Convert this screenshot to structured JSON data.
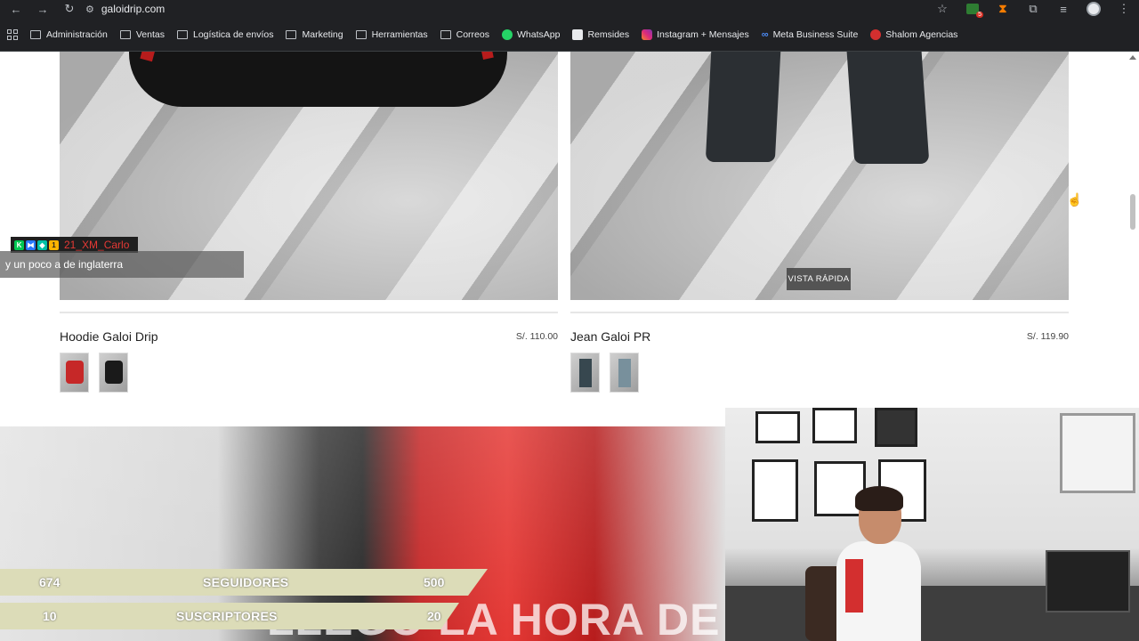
{
  "browser": {
    "url": "galoidrip.com",
    "bookmarks": [
      {
        "label": "Administración",
        "icon": "folder-icon"
      },
      {
        "label": "Ventas",
        "icon": "folder-icon"
      },
      {
        "label": "Logística de envíos",
        "icon": "folder-icon"
      },
      {
        "label": "Marketing",
        "icon": "folder-icon"
      },
      {
        "label": "Herramientas",
        "icon": "folder-icon"
      },
      {
        "label": "Correos",
        "icon": "folder-icon"
      },
      {
        "label": "WhatsApp",
        "icon": "whatsapp-icon"
      },
      {
        "label": "Remsides",
        "icon": "remsides-icon"
      },
      {
        "label": "Instagram + Mensajes",
        "icon": "instagram-icon"
      },
      {
        "label": "Meta Business Suite",
        "icon": "meta-icon"
      },
      {
        "label": "Shalom Agencias",
        "icon": "shalom-icon"
      }
    ],
    "extension_badge": "5"
  },
  "products": [
    {
      "name": "Hoodie Galoi Drip",
      "price": "S/. 110.00",
      "swatches": [
        "red",
        "black"
      ]
    },
    {
      "name": "Jean Galoi PR",
      "price": "S/. 119.90",
      "swatches": [
        "dark",
        "green"
      ],
      "quick_view_label": "VISTA RÁPIDA"
    }
  ],
  "chat": {
    "username": "21_XM_Carlo",
    "message": "y un poco a de inglaterra",
    "badges": [
      "K",
      "⧓",
      "◆",
      "1"
    ]
  },
  "stream": {
    "followers": {
      "current": "674",
      "label": "SEGUIDORES",
      "goal": "500"
    },
    "subscribers": {
      "current": "10",
      "label": "SUSCRIPTORES",
      "goal": "20"
    },
    "banner_text": "LLEGO LA HORA DE"
  }
}
